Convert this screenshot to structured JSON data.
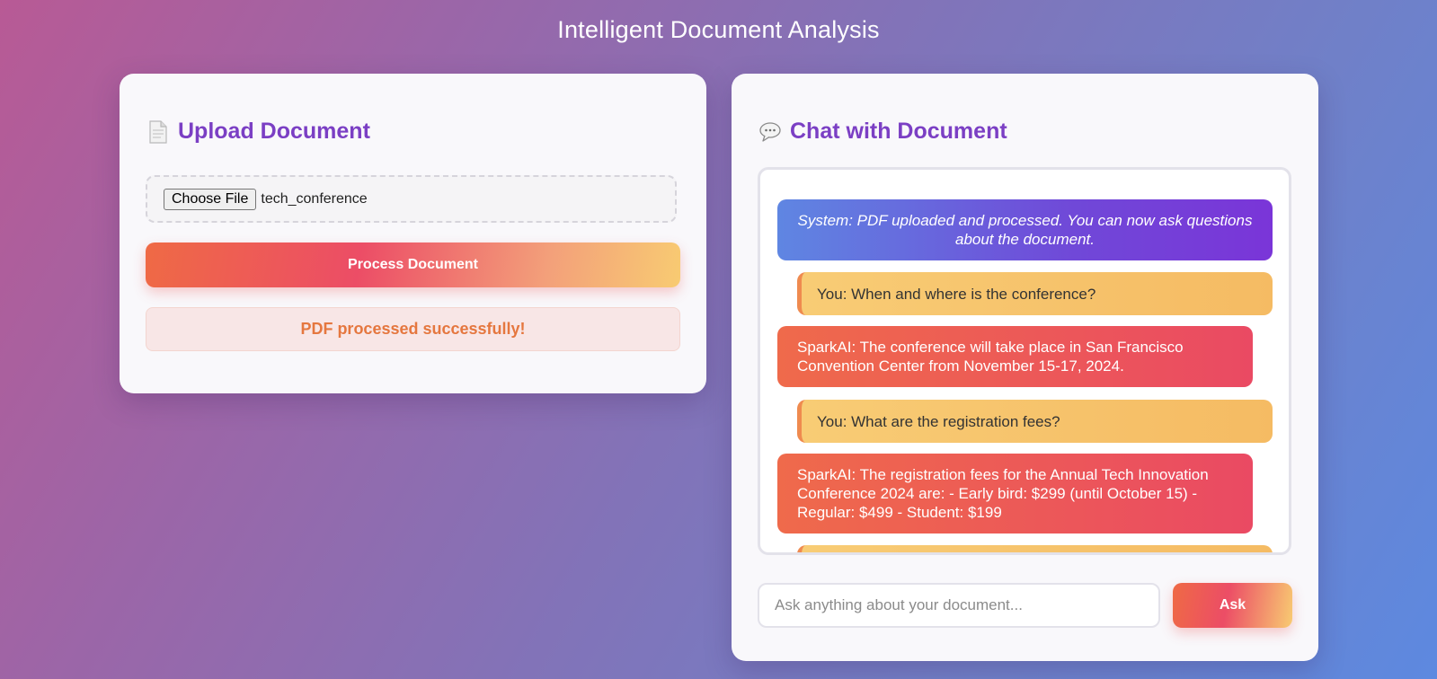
{
  "app": {
    "title": "Intelligent Document Analysis"
  },
  "upload": {
    "icon": "document-icon",
    "title": "Upload Document",
    "choose_file_label": "Choose File",
    "file_name": "tech_conference",
    "process_label": "Process Document",
    "status_message": "PDF processed successfully!"
  },
  "chat": {
    "icon": "speech-bubble-icon",
    "title": "Chat with Document",
    "messages": [
      {
        "role": "system",
        "text": "System: PDF uploaded and processed. You can now ask questions about the document."
      },
      {
        "role": "user",
        "text": "You: When and where is the conference?"
      },
      {
        "role": "ai",
        "text": "SparkAI: The conference will take place in San Francisco Convention Center from November 15-17, 2024."
      },
      {
        "role": "user",
        "text": "You: What are the registration fees?"
      },
      {
        "role": "ai",
        "text": "SparkAI: The registration fees for the Annual Tech Innovation Conference 2024 are: - Early bird: $299 (until October 15) - Regular: $499 - Student: $199"
      },
      {
        "role": "user",
        "text": ""
      }
    ],
    "input_placeholder": "Ask anything about your document...",
    "input_value": "",
    "ask_label": "Ask"
  },
  "colors": {
    "accent_title": "#7b3fc4",
    "status_text": "#e5773f",
    "system_bubble": "#7048d8",
    "user_bubble": "#f5bb63",
    "ai_bubble": "#ea4a63"
  }
}
